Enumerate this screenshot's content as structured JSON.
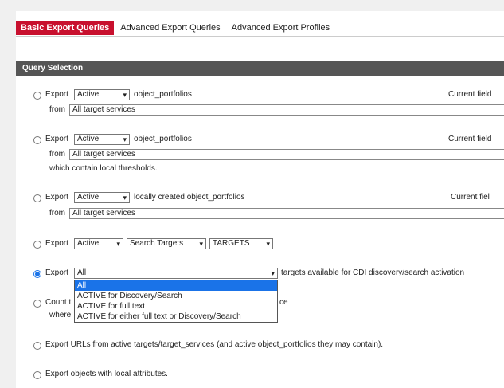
{
  "tabs": [
    "Basic Export Queries",
    "Advanced Export Queries",
    "Advanced Export Profiles"
  ],
  "section_title": "Query Selection",
  "q1": {
    "export": "Export",
    "sel": "Active",
    "obj": "object_portfolios",
    "current": "Current field",
    "from": "from",
    "field": "All target services"
  },
  "q2": {
    "export": "Export",
    "sel": "Active",
    "obj": "object_portfolios",
    "current": "Current field",
    "from": "from",
    "field": "All target services",
    "note": "which contain local thresholds."
  },
  "q3": {
    "export": "Export",
    "sel": "Active",
    "obj": "locally created object_portfolios",
    "current": "Current fiel",
    "from": "from",
    "field": "All target services"
  },
  "q4": {
    "export": "Export",
    "sel1": "Active",
    "sel2": "Search Targets",
    "sel3": "TARGETS"
  },
  "q5": {
    "export": "Export",
    "sel": "All",
    "suffix": "targets available for CDI discovery/search activation",
    "options": [
      "All",
      "ACTIVE for Discovery/Search",
      "ACTIVE for full text",
      "ACTIVE for either full text or Discovery/Search"
    ]
  },
  "q6": {
    "count_prefix": "Count t",
    "count_suffix": "ce",
    "where": "where"
  },
  "q7": {
    "text": "Export URLs from active targets/target_services (and active object_portfolios they may contain)."
  },
  "q8": {
    "text": "Export objects with local attributes."
  }
}
